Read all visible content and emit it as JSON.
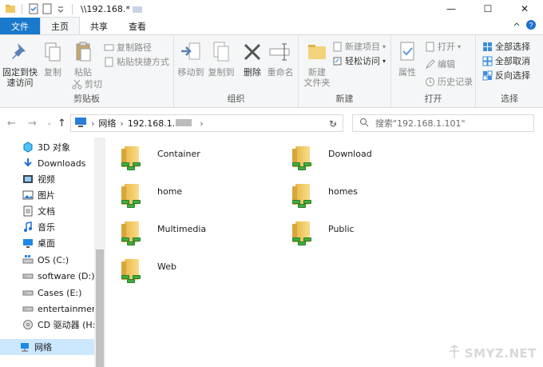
{
  "window": {
    "title": "\\\\192.168.*"
  },
  "titlebar": {
    "minimize": "—",
    "maximize": "☐",
    "close": "✕"
  },
  "tabs": {
    "file": "文件",
    "home": "主页",
    "share": "共享",
    "view": "查看"
  },
  "ribbon": {
    "clipboard": {
      "pin": "固定到快速访问",
      "pin_l1": "固定到快",
      "pin_l2": "速访问",
      "copy": "复制",
      "paste": "粘贴",
      "copy_path": "复制路径",
      "paste_shortcut": "粘贴快捷方式",
      "cut": "剪切",
      "label": "剪贴板"
    },
    "organize": {
      "move_to": "移动到",
      "copy_to": "复制到",
      "delete": "删除",
      "rename": "重命名",
      "label": "组织"
    },
    "new": {
      "new_folder_l1": "新建",
      "new_folder_l2": "文件夹",
      "new_item": "新建项目",
      "easy_access": "轻松访问",
      "label": "新建"
    },
    "open": {
      "properties": "属性",
      "open": "打开",
      "edit": "编辑",
      "history": "历史记录",
      "label": "打开"
    },
    "select": {
      "select_all": "全部选择",
      "select_none": "全部取消",
      "invert": "反向选择",
      "label": "选择"
    }
  },
  "address": {
    "root": "网络",
    "host": "192.168.1."
  },
  "search": {
    "placeholder": "搜索\"192.168.1.101\""
  },
  "sidebar": {
    "items": [
      {
        "label": "3D 对象",
        "icon": "3d-objects-icon"
      },
      {
        "label": "Downloads",
        "icon": "download-icon"
      },
      {
        "label": "视频",
        "icon": "video-icon"
      },
      {
        "label": "图片",
        "icon": "picture-icon"
      },
      {
        "label": "文档",
        "icon": "document-icon"
      },
      {
        "label": "音乐",
        "icon": "music-icon"
      },
      {
        "label": "桌面",
        "icon": "desktop-icon"
      },
      {
        "label": "OS (C:)",
        "icon": "windows-drive-icon"
      },
      {
        "label": "software (D:)",
        "icon": "drive-icon"
      },
      {
        "label": "Cases (E:)",
        "icon": "drive-icon"
      },
      {
        "label": "entertainment (",
        "icon": "drive-icon"
      },
      {
        "label": "CD 驱动器 (H:)",
        "icon": "cd-drive-icon"
      },
      {
        "label": "网络",
        "icon": "network-icon"
      }
    ]
  },
  "files": [
    "Container",
    "Download",
    "home",
    "homes",
    "Multimedia",
    "Public",
    "Web"
  ],
  "watermark": "SMYZ.NET",
  "colors": {
    "file_tab": "#1979ca",
    "selection": "#cce8ff",
    "folder": "#f2c864",
    "share": "#3fae3f"
  }
}
